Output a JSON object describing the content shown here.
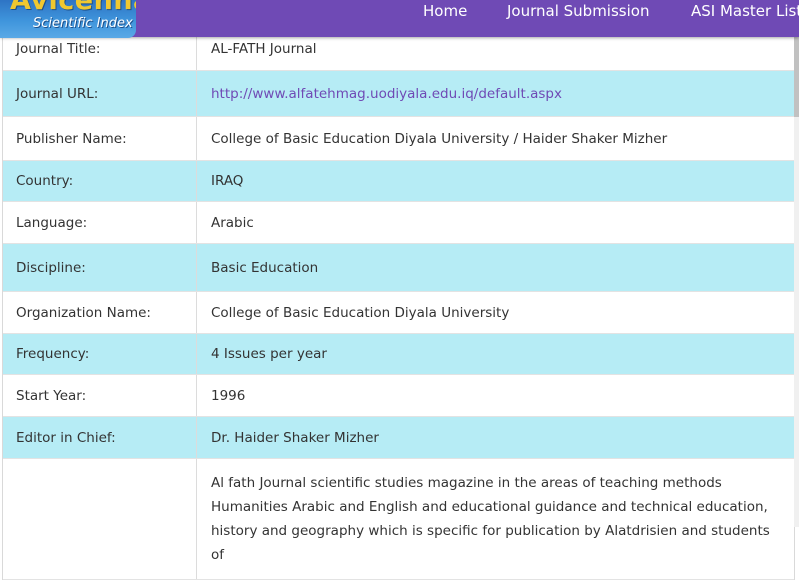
{
  "logo": {
    "title": "Avicenna",
    "subtitle": "Scientific Index"
  },
  "nav": {
    "items": [
      "Home",
      "Journal Submission",
      "ASI Master List"
    ]
  },
  "journal": {
    "rows": [
      {
        "label": "Journal Title:",
        "value": "AL-FATH Journal"
      },
      {
        "label": "Journal URL:",
        "value": "http://www.alfatehmag.uodiyala.edu.iq/default.aspx"
      },
      {
        "label": "Publisher Name:",
        "value": "College of Basic Education Diyala University / Haider Shaker Mizher"
      },
      {
        "label": "Country:",
        "value": "IRAQ"
      },
      {
        "label": "Language:",
        "value": "Arabic"
      },
      {
        "label": "Discipline:",
        "value": "Basic Education"
      },
      {
        "label": "Organization Name:",
        "value": "College of Basic Education Diyala University"
      },
      {
        "label": "Frequency:",
        "value": "4 Issues per year"
      },
      {
        "label": "Start Year:",
        "value": "1996"
      },
      {
        "label": "Editor in Chief:",
        "value": "Dr. Haider Shaker Mizher"
      },
      {
        "label": "",
        "value": "Al fath Journal scientific studies magazine in the areas of teaching methods Humanities Arabic and English and educational guidance and technical education, history and geography which is specific for publication by Alatdrisien and students of"
      }
    ]
  },
  "colors": {
    "nav": "#6f4ab5",
    "row_alt": "#b6ecf5",
    "link": "#6f4ab5"
  }
}
